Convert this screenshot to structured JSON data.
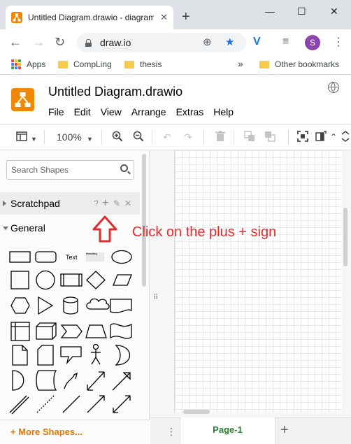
{
  "browser": {
    "tab_title": "Untitled Diagram.drawio - diagrams.net",
    "tab_close": "✕",
    "new_tab": "+",
    "url": "draw.io",
    "avatar_letter": "S",
    "bookmarks": [
      {
        "label": "Apps"
      },
      {
        "label": "CompLing"
      },
      {
        "label": "thesis"
      },
      {
        "label": "Other bookmarks"
      }
    ],
    "overflow": "»"
  },
  "app": {
    "title": "Untitled Diagram.drawio",
    "menu": [
      "File",
      "Edit",
      "View",
      "Arrange",
      "Extras",
      "Help"
    ],
    "zoom": "100%",
    "brand_color": "#f08705"
  },
  "sidebar": {
    "search_placeholder": "Search Shapes",
    "scratchpad_label": "Scratchpad",
    "scratchpad_help": "?",
    "scratchpad_add": "+",
    "scratchpad_close": "✕",
    "general_label": "General",
    "text_shape_label": "Text",
    "heading_shape_label": "Heading",
    "more_shapes": "+ More Shapes..."
  },
  "canvas": {
    "page_label": "Page-1",
    "add_page": "+"
  },
  "annotation": {
    "text": "Click on the plus + sign",
    "color": "#e32b2b"
  }
}
